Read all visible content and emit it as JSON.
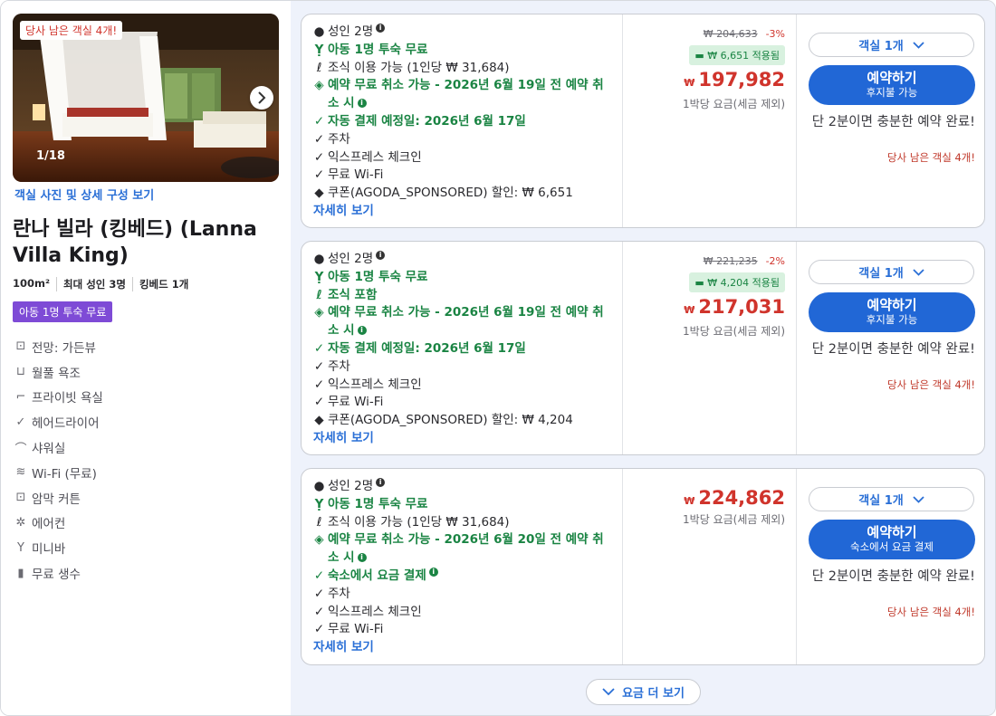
{
  "left": {
    "photo": {
      "urgent": "당사 남은 객실 4개!",
      "counter": "1/18"
    },
    "photo_link": "객실 사진 및 상세 구성 보기",
    "title": "란나 빌라 (킹베드) (Lanna Villa King)",
    "specs": [
      "100m²",
      "최대 성인 3명",
      "킹베드 1개"
    ],
    "kid_badge": "아동 1명 투숙 무료",
    "amenities": [
      {
        "icon": "view-icon",
        "label": "전망: 가든뷰"
      },
      {
        "icon": "bathtub-icon",
        "label": "월풀 욕조"
      },
      {
        "icon": "toilet-icon",
        "label": "프라이빗 욕실"
      },
      {
        "icon": "check-icon",
        "label": "헤어드라이어"
      },
      {
        "icon": "shower-icon",
        "label": "샤워실"
      },
      {
        "icon": "wifi-icon",
        "label": "Wi-Fi (무료)"
      },
      {
        "icon": "curtain-icon",
        "label": "암막 커튼"
      },
      {
        "icon": "aircon-icon",
        "label": "에어컨"
      },
      {
        "icon": "minibar-icon",
        "label": "미니바"
      },
      {
        "icon": "water-icon",
        "label": "무료 생수"
      }
    ]
  },
  "offers": [
    {
      "guests": "성인 2명",
      "kid_free": "아동 1명 투숙 무료",
      "meal": "조식 이용 가능 (1인당 ₩ 31,684)",
      "meal_included": false,
      "cancel": "예약 무료 취소 가능 - 2026년 6월 19일 전 예약 취소 시",
      "payment": "자동 결제 예정일: 2026년 6월 17일",
      "parking": "주차",
      "express": "익스프레스 체크인",
      "wifi": "무료 Wi-Fi",
      "coupon": "쿠폰(AGODA_SPONSORED) 할인: ₩ 6,651",
      "more": "자세히 보기",
      "original_price": "₩ 204,633",
      "discount_pct": "-3%",
      "coupon_applied": "₩ 6,651 적용됨",
      "currency": "₩",
      "price": "197,982",
      "per_night": "1박당 요금(세금 제외)",
      "qty": "객실 1개",
      "book_label": "예약하기",
      "book_sub": "후지불 가능",
      "note": "단 2분이면 충분한 예약 완료!",
      "avail": "당사 남은 객실 4개!"
    },
    {
      "guests": "성인 2명",
      "kid_free": "아동 1명 투숙 무료",
      "meal": "조식 포함",
      "meal_included": true,
      "cancel": "예약 무료 취소 가능 - 2026년 6월 19일 전 예약 취소 시",
      "payment": "자동 결제 예정일: 2026년 6월 17일",
      "parking": "주차",
      "express": "익스프레스 체크인",
      "wifi": "무료 Wi-Fi",
      "coupon": "쿠폰(AGODA_SPONSORED) 할인: ₩ 4,204",
      "more": "자세히 보기",
      "original_price": "₩ 221,235",
      "discount_pct": "-2%",
      "coupon_applied": "₩ 4,204 적용됨",
      "currency": "₩",
      "price": "217,031",
      "per_night": "1박당 요금(세금 제외)",
      "qty": "객실 1개",
      "book_label": "예약하기",
      "book_sub": "후지불 가능",
      "note": "단 2분이면 충분한 예약 완료!",
      "avail": "당사 남은 객실 4개!"
    },
    {
      "guests": "성인 2명",
      "kid_free": "아동 1명 투숙 무료",
      "meal": "조식 이용 가능 (1인당 ₩ 31,684)",
      "meal_included": false,
      "cancel": "예약 무료 취소 가능 - 2026년 6월 20일 전 예약 취소 시",
      "payment": "숙소에서 요금 결제",
      "parking": "주차",
      "express": "익스프레스 체크인",
      "wifi": "무료 Wi-Fi",
      "more": "자세히 보기",
      "currency": "₩",
      "price": "224,862",
      "per_night": "1박당 요금(세금 제외)",
      "qty": "객실 1개",
      "book_label": "예약하기",
      "book_sub": "숙소에서 요금 결제",
      "note": "단 2분이면 충분한 예약 완료!",
      "avail": "당사 남은 객실 4개!"
    }
  ],
  "see_more": "요금 더 보기",
  "colors": {
    "accent": "#2167d6",
    "price": "#d0342c",
    "green": "#1a8443",
    "badge": "#7e4bd6"
  }
}
